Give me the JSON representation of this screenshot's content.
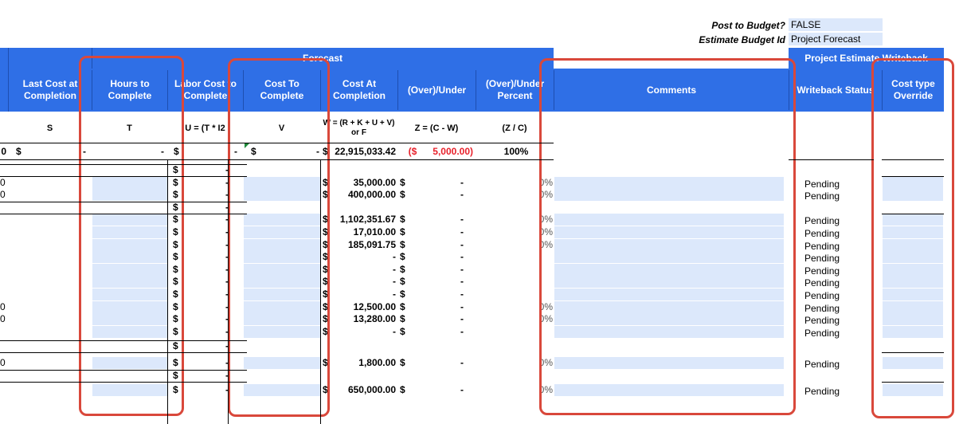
{
  "top": {
    "post_to_budget_label": "Post to Budget?",
    "post_to_budget_value": "FALSE",
    "estimate_budget_id_label": "Estimate Budget Id",
    "estimate_budget_id_value": "Project Forecast"
  },
  "group_headers": {
    "forecast": "Forecast",
    "writeback": "Project Estimate Writeback"
  },
  "columns": [
    {
      "key": "last_cost",
      "label": "Last Cost at Completion",
      "letter": "S"
    },
    {
      "key": "hours",
      "label": "Hours to Complete",
      "letter": "T"
    },
    {
      "key": "labor",
      "label": "Labor Cost to Complete",
      "letter": "U = (T * I2"
    },
    {
      "key": "cost_to",
      "label": "Cost To Complete",
      "letter": "V"
    },
    {
      "key": "cost_at",
      "label": "Cost At Completion",
      "letter": "W = (R + K + U + V) or F"
    },
    {
      "key": "over",
      "label": "(Over)/Under",
      "letter": "Z = (C - W)"
    },
    {
      "key": "over_pct",
      "label": "(Over)/Under Percent",
      "letter": "(Z / C)"
    },
    {
      "key": "comments",
      "label": "Comments",
      "letter": ""
    },
    {
      "key": "wb_status",
      "label": "Writeback Status",
      "letter": ""
    },
    {
      "key": "cost_type",
      "label": "Cost type Override",
      "letter": ""
    }
  ],
  "total_row": {
    "left_fragment": "0",
    "last_cost_sym": "$",
    "last_cost_val": "-",
    "hours_val": "-",
    "labor_sym": "$",
    "labor_val": "-",
    "cost_to_sym": "$",
    "cost_to_val": "-",
    "cost_at_sym": "$",
    "cost_at_val": "22,915,033.42",
    "over_val": "($      5,000.00)",
    "pct": "100%"
  },
  "rows": [
    {
      "left": "",
      "cost_at": "",
      "over": "",
      "pct": "",
      "status": "",
      "labor": true,
      "sym": false
    },
    {
      "left": "0",
      "cost_at": "35,000.00",
      "over": "-",
      "pct": "0%",
      "status": "Pending",
      "labor": true,
      "sym": true
    },
    {
      "left": "0",
      "cost_at": "400,000.00",
      "over": "-",
      "pct": "0%",
      "status": "Pending",
      "labor": true,
      "sym": true
    },
    {
      "left": "",
      "cost_at": "",
      "over": "",
      "pct": "",
      "status": "",
      "labor": true,
      "sym": false
    },
    {
      "left": "",
      "cost_at": "1,102,351.67",
      "over": "-",
      "pct": "0%",
      "status": "Pending",
      "labor": true,
      "sym": true
    },
    {
      "left": "",
      "cost_at": "17,010.00",
      "over": "-",
      "pct": "0%",
      "status": "Pending",
      "labor": true,
      "sym": true
    },
    {
      "left": "",
      "cost_at": "185,091.75",
      "over": "-",
      "pct": "0%",
      "status": "Pending",
      "labor": true,
      "sym": true
    },
    {
      "left": "",
      "cost_at": "-",
      "over": "-",
      "pct": "",
      "status": "Pending",
      "labor": true,
      "sym": true
    },
    {
      "left": "",
      "cost_at": "-",
      "over": "-",
      "pct": "",
      "status": "Pending",
      "labor": true,
      "sym": true
    },
    {
      "left": "",
      "cost_at": "-",
      "over": "-",
      "pct": "",
      "status": "Pending",
      "labor": true,
      "sym": true
    },
    {
      "left": "",
      "cost_at": "-",
      "over": "-",
      "pct": "",
      "status": "Pending",
      "labor": true,
      "sym": true
    },
    {
      "left": "0",
      "cost_at": "12,500.00",
      "over": "-",
      "pct": "0%",
      "status": "Pending",
      "labor": true,
      "sym": true
    },
    {
      "left": "0",
      "cost_at": "13,280.00",
      "over": "-",
      "pct": "0%",
      "status": "Pending",
      "labor": true,
      "sym": true
    },
    {
      "left": "",
      "cost_at": "-",
      "over": "-",
      "pct": "",
      "status": "Pending",
      "labor": true,
      "sym": true
    },
    {
      "left": "",
      "cost_at": "",
      "over": "",
      "pct": "",
      "status": "",
      "labor": true,
      "sym": false
    },
    {
      "left": "0",
      "cost_at": "1,800.00",
      "over": "-",
      "pct": "0%",
      "status": "Pending",
      "labor": true,
      "sym": true
    },
    {
      "left": "",
      "cost_at": "",
      "over": "",
      "pct": "",
      "status": "",
      "labor": true,
      "sym": false
    },
    {
      "left": "",
      "cost_at": "650,000.00",
      "over": "-",
      "pct": "0%",
      "status": "Pending",
      "labor": true,
      "sym": true
    }
  ],
  "symbols": {
    "dollar": "$",
    "dash": "-"
  }
}
